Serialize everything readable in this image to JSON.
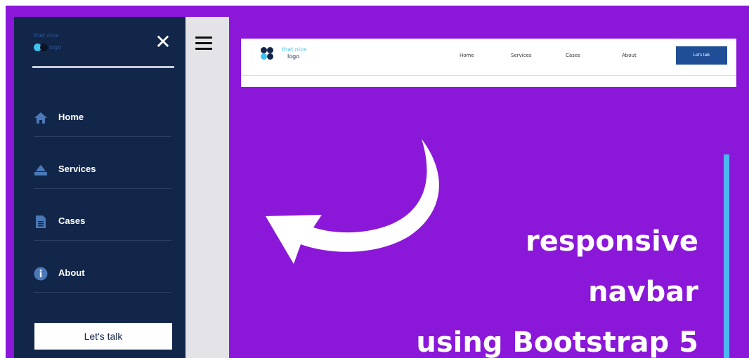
{
  "sidebar": {
    "logo": {
      "line1": "that nice",
      "line2": "logo"
    },
    "items": [
      {
        "label": "Home",
        "icon": "home-icon"
      },
      {
        "label": "Services",
        "icon": "services-icon"
      },
      {
        "label": "Cases",
        "icon": "document-icon"
      },
      {
        "label": "About",
        "icon": "info-icon"
      }
    ],
    "cta_label": "Let's talk"
  },
  "navbar": {
    "logo": {
      "line1": "that nice",
      "line2": "logo"
    },
    "links": [
      "Home",
      "Services",
      "Cases",
      "About"
    ],
    "cta_label": "Let's talk"
  },
  "hero": {
    "lines": [
      "responsive",
      "navbar",
      "using Bootstrap 5"
    ]
  },
  "colors": {
    "background": "#8b17d8",
    "sidebar": "#12264a",
    "accent": "#4bb6f0",
    "button": "#1f4d96"
  }
}
